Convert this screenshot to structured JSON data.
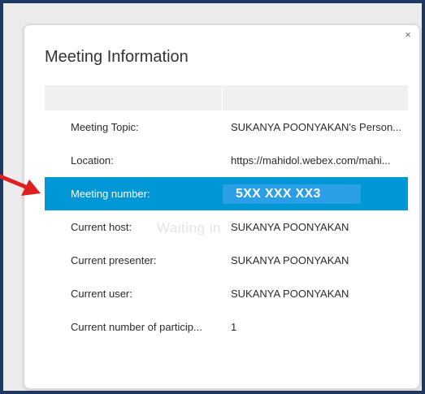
{
  "dialog": {
    "title": "Meeting Information",
    "close_glyph": "×"
  },
  "table": {
    "rows": [
      {
        "label": "Meeting Topic:",
        "value": "SUKANYA POONYAKAN's Person..."
      },
      {
        "label": "Location:",
        "value": "https://mahidol.webex.com/mahi..."
      },
      {
        "label": "Meeting number:",
        "value": "5XX XXX XX3"
      },
      {
        "label": "Current host:",
        "value": "SUKANYA POONYAKAN"
      },
      {
        "label": "Current presenter:",
        "value": "SUKANYA POONYAKAN"
      },
      {
        "label": "Current user:",
        "value": "SUKANYA POONYAKAN"
      },
      {
        "label": "Current number of particip...",
        "value": "1"
      }
    ]
  },
  "watermark": "Waiting                        in",
  "colors": {
    "selected_row": "#0097d7",
    "number_box": "#2b9ee8",
    "arrow": "#e02020",
    "frame": "#1f3763"
  },
  "icons": {
    "close": "close-icon",
    "annotation": "red-arrow-icon"
  }
}
